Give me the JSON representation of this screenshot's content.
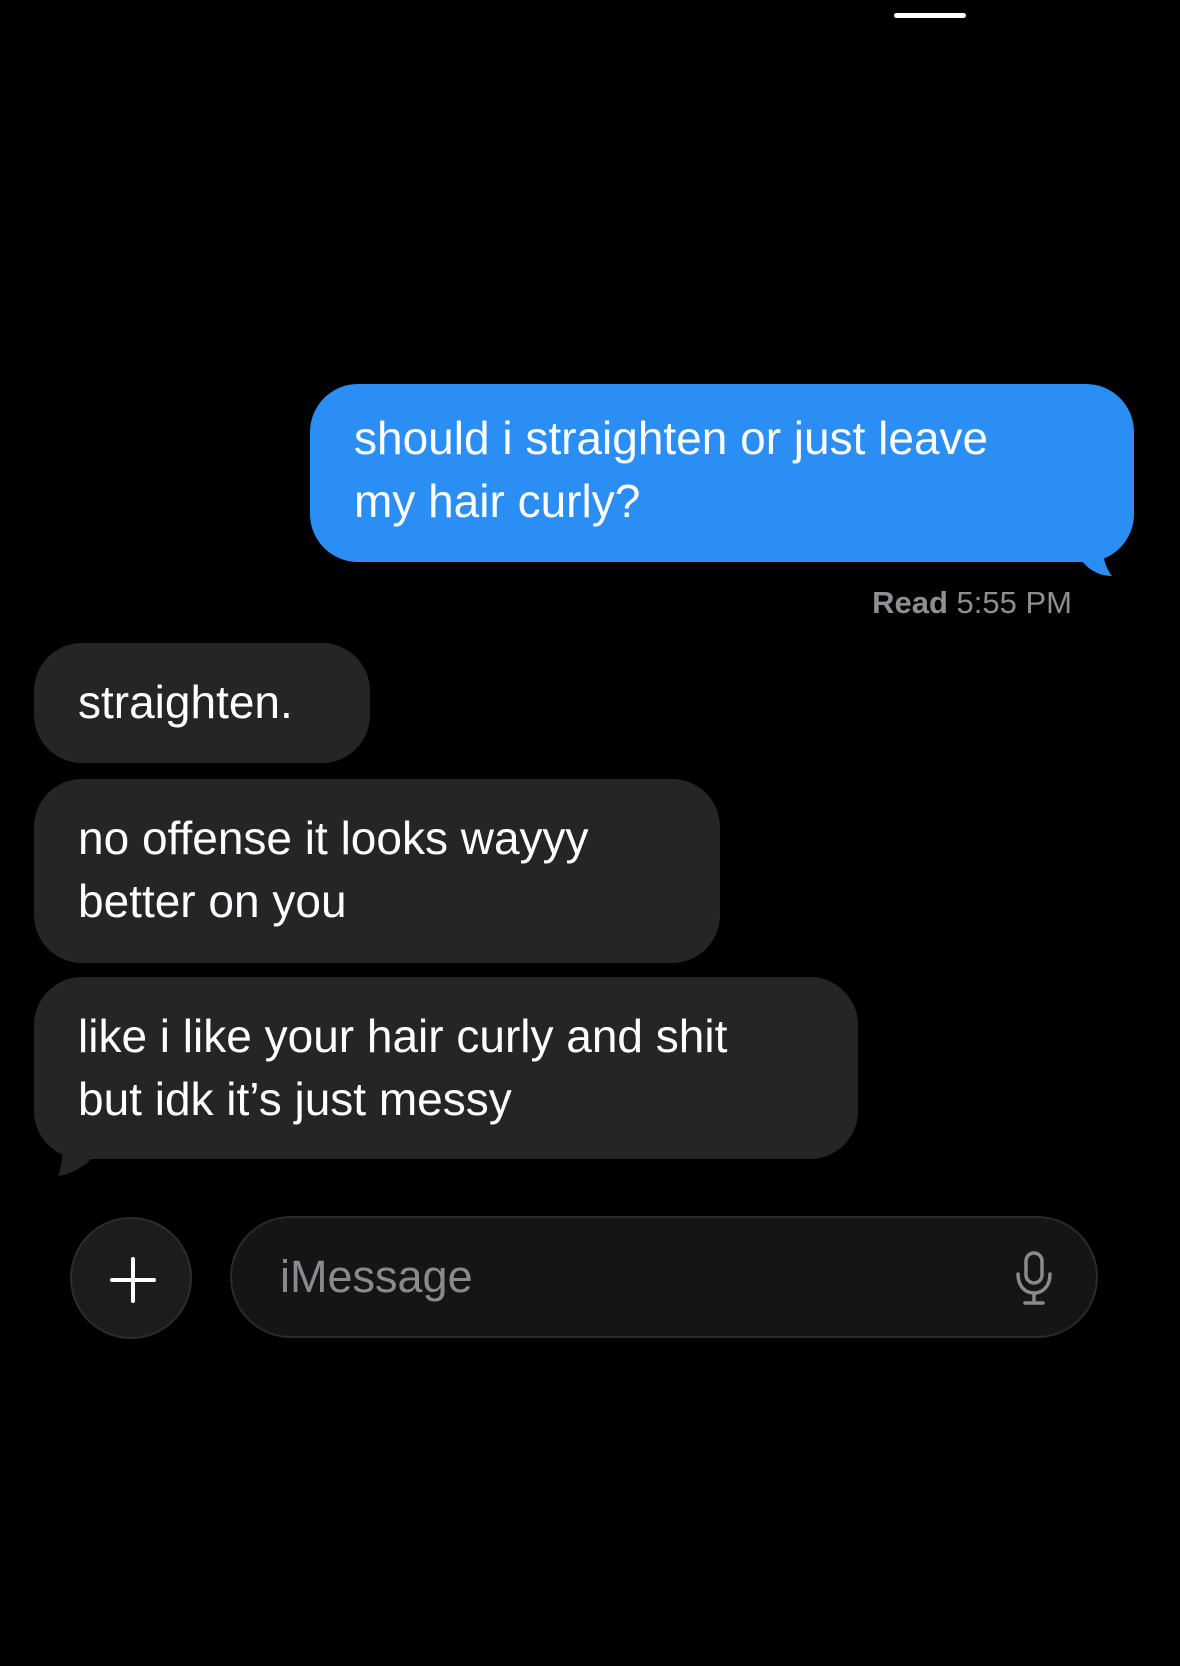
{
  "conversation": {
    "messages": [
      {
        "direction": "sent",
        "text": "should i straighten or just leave\nmy hair curly?"
      },
      {
        "direction": "received",
        "text": "straighten."
      },
      {
        "direction": "received",
        "text": "no offense it looks wayyy\nbetter on you"
      },
      {
        "direction": "received",
        "text": "like i like your hair curly and shit\nbut idk it’s just messy"
      }
    ],
    "read_receipt": {
      "label": "Read",
      "time": "5:55 PM"
    }
  },
  "composer": {
    "placeholder": "iMessage",
    "add_icon": "plus-icon",
    "mic_icon": "microphone-icon"
  },
  "colors": {
    "background": "#000000",
    "sent_bubble": "#2a8ef5",
    "received_bubble": "#252527",
    "secondary_text": "#8e8e93"
  }
}
